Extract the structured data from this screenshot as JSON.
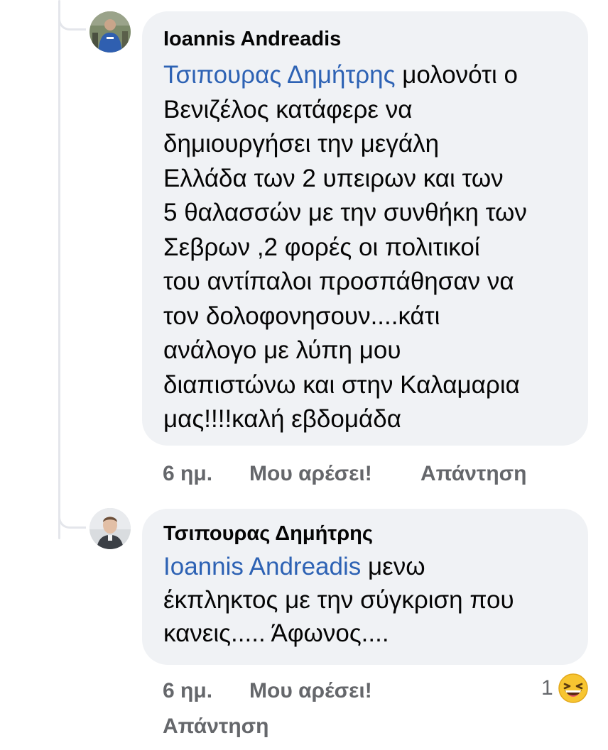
{
  "comments": [
    {
      "author": "Ioannis Andreadis",
      "avatar_icon": "user-avatar-icon",
      "mention": "Τσιπουρας Δημήτρης",
      "lines": [
        " μολονότι ο",
        "Βενιζέλος κατάφερε να",
        "δημιουργήσει την μεγάλη",
        "Ελλάδα των 2 υπειρων και των",
        "5 θαλασσών με την συνθήκη των",
        "Σεβρων ,2 φορές οι πολιτικοί",
        "του αντίπαλοι προσπάθησαν να",
        "τον δολοφονησουν....κάτι",
        "ανάλογο με λύπη μου",
        "διαπιστώνω και στην Καλαμαρια",
        "μας!!!!καλή εβδομάδα"
      ],
      "time": "6 ημ.",
      "like_label": "Μου αρέσει!",
      "reply_label": "Απάντηση"
    },
    {
      "author": "Τσιπουρας Δημήτρης",
      "avatar_icon": "user-avatar-icon",
      "mention": "Ioannis Andreadis",
      "lines": [
        " μενω",
        "έκπληκτος με την σύγκριση που",
        "κανεις..... Άφωνος...."
      ],
      "time": "6 ημ.",
      "like_label": "Μου αρέσει!",
      "reply_label": "Απάντηση",
      "reaction": {
        "count": "1",
        "icon": "laughing-emoji-icon"
      }
    }
  ],
  "colors": {
    "bubble_bg": "#f0f2f5",
    "mention": "#2d62b4",
    "meta_text": "#65676b",
    "thread_line": "#e4e6eb"
  }
}
